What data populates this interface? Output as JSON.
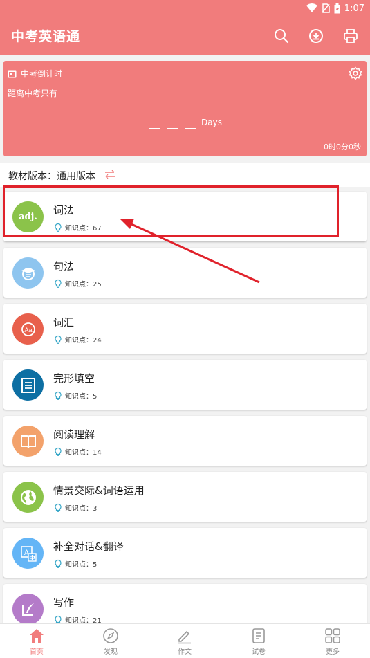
{
  "status_bar": {
    "time": "1:07"
  },
  "app_bar": {
    "title": "中考英语通"
  },
  "countdown": {
    "title": "中考倒计时",
    "subtitle": "距离中考只有",
    "days_label": "Days",
    "timer": "0时0分0秒"
  },
  "version": {
    "label": "教材版本：通用版本"
  },
  "list": {
    "items": [
      {
        "title": "词法",
        "knowledge": "知识点：67",
        "color": "#8bc34a",
        "icon": "adj-icon"
      },
      {
        "title": "句法",
        "knowledge": "知识点：25",
        "color": "#8ec5ef",
        "icon": "graduate-icon"
      },
      {
        "title": "词汇",
        "knowledge": "知识点：24",
        "color": "#e8604c",
        "icon": "font-icon"
      },
      {
        "title": "完形填空",
        "knowledge": "知识点：5",
        "color": "#0d6fa3",
        "icon": "document-icon"
      },
      {
        "title": "阅读理解",
        "knowledge": "知识点：14",
        "color": "#f3a26b",
        "icon": "book-icon"
      },
      {
        "title": "情景交际&词语运用",
        "knowledge": "知识点：3",
        "color": "#8bc34a",
        "icon": "globe-icon"
      },
      {
        "title": "补全对话&翻译",
        "knowledge": "知识点：5",
        "color": "#64b5f6",
        "icon": "translate-icon"
      },
      {
        "title": "写作",
        "knowledge": "知识点：21",
        "color": "#b47bc9",
        "icon": "quill-icon"
      }
    ]
  },
  "bottom_nav": {
    "items": [
      {
        "label": "首页",
        "icon": "home-icon"
      },
      {
        "label": "发现",
        "icon": "compass-icon"
      },
      {
        "label": "作文",
        "icon": "pencil-icon"
      },
      {
        "label": "试卷",
        "icon": "paper-icon"
      },
      {
        "label": "更多",
        "icon": "grid-icon"
      }
    ]
  },
  "colors": {
    "accent": "#f17c7c",
    "annotation": "#e0222b"
  }
}
